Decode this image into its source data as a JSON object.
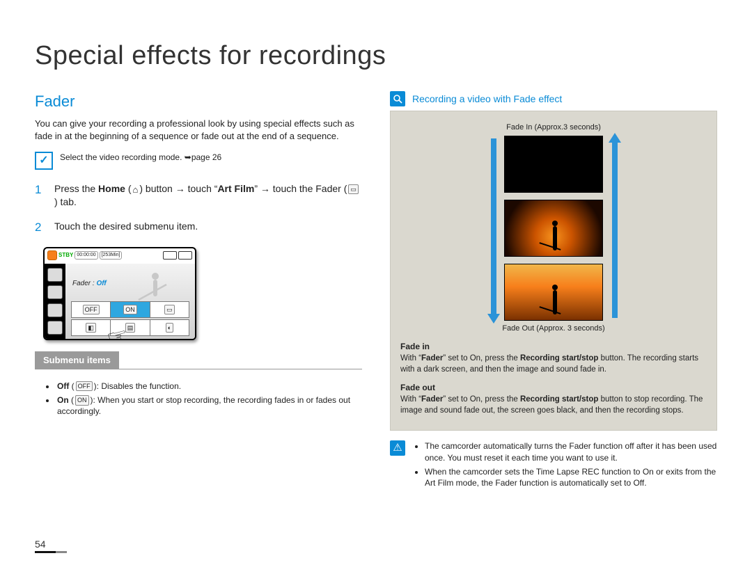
{
  "page_title": "Special effects for recordings",
  "page_number": "54",
  "left": {
    "heading": "Fader",
    "intro": "You can give your recording a professional look by using special effects such as fade in at the beginning of a sequence or fade out at the end of a sequence.",
    "precheck": "Select the video recording mode. ➥page 26",
    "step1_pre": "Press the ",
    "step1_home": "Home",
    "step1_mid1": " button → touch “",
    "step1_artfilm": "Art Film",
    "step1_mid2": "” → touch the Fader ",
    "step1_post": " tab.",
    "step2": "Touch the desired submenu item.",
    "lcd": {
      "stby": "STBY",
      "time": "00:00:00",
      "remain": "[253Min]",
      "fader_label": "Fader : ",
      "fader_state": "Off"
    },
    "submenu_title": "Submenu items",
    "submenu": [
      {
        "b": "Off",
        "icon": "OFF",
        "t": ": Disables the function."
      },
      {
        "b": "On",
        "icon": "ON",
        "t": ": When you start or stop recording, the recording fades in or fades out accordingly."
      }
    ]
  },
  "right": {
    "zoom_title": "Recording a video with Fade effect",
    "fade_in_caption": "Fade In (Approx.3 seconds)",
    "fade_out_caption": "Fade Out (Approx. 3 seconds)",
    "fade_in_h": "Fade in",
    "fade_in_p_pre": "With “",
    "fade_in_p_b1": "Fader",
    "fade_in_p_mid": "” set to On, press the ",
    "fade_in_p_b2": "Recording start/stop",
    "fade_in_p_post": " button. The recording starts with a dark screen, and then the image and sound fade in.",
    "fade_out_h": "Fade out",
    "fade_out_p_pre": "With “",
    "fade_out_p_b1": "Fader",
    "fade_out_p_mid": "” set to On, press the ",
    "fade_out_p_b2": "Recording start/stop",
    "fade_out_p_post": " button to stop recording. The image and sound fade out, the screen goes black, and then the recording stops.",
    "notes": [
      "The camcorder automatically turns the Fader function off after it has been used once. You must reset it each time you want to use it.",
      "When the camcorder sets the Time Lapse REC function to On or exits from the Art Film mode, the Fader function is automatically set to Off."
    ]
  }
}
